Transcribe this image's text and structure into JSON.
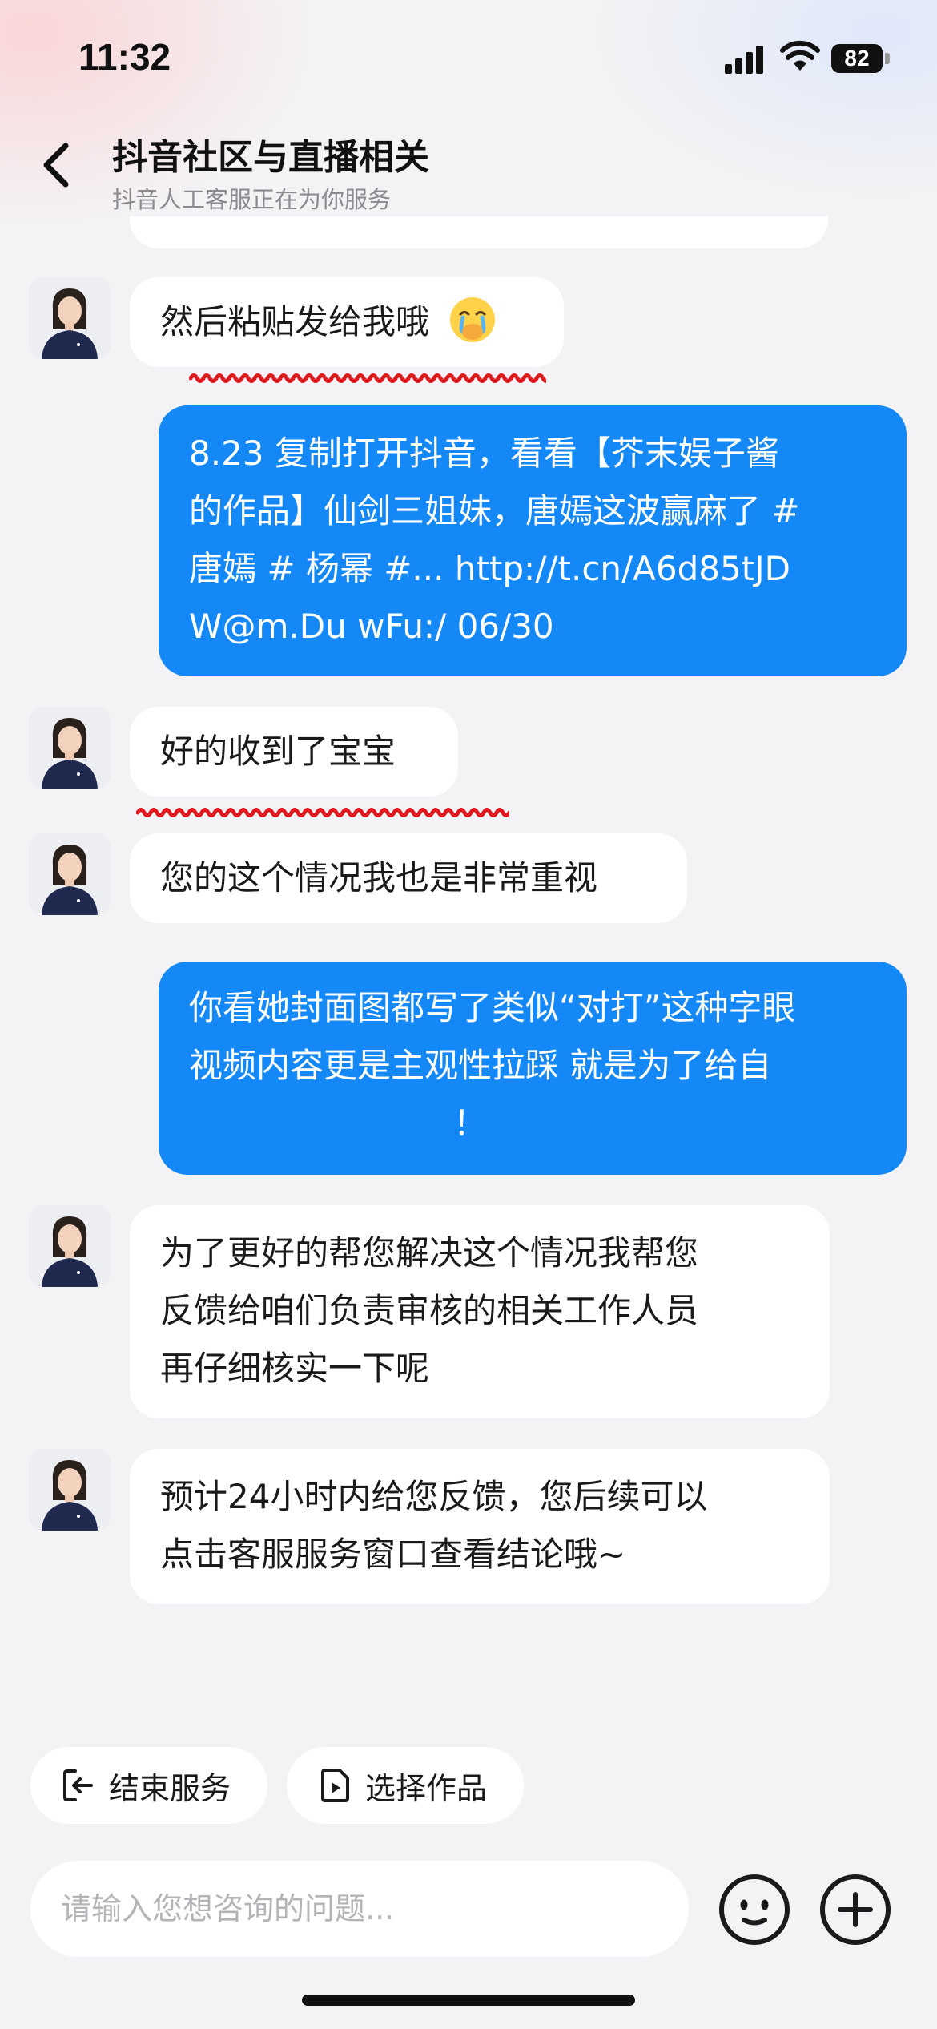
{
  "status_bar": {
    "time": "11:32",
    "battery": "82"
  },
  "header": {
    "title": "抖音社区与直播相关",
    "subtitle": "抖音人工客服正在为你服务"
  },
  "messages": [
    {
      "from": "agent",
      "text": "然后粘贴发给我哦",
      "emoji": "crying-hand-over-mouth-emoji"
    },
    {
      "from": "user",
      "lines": [
        "8.23 复制打开抖音，看看【芥末娱子酱",
        "的作品】仙剑三姐妹，唐嫣这波赢麻了 #",
        "唐嫣 # 杨幂 #... http://t.cn/A6d85tJD",
        "W@m.Du wFu:/ 06/30"
      ]
    },
    {
      "from": "agent",
      "text": "好的收到了宝宝"
    },
    {
      "from": "agent",
      "text": "您的这个情况我也是非常重视"
    },
    {
      "from": "user",
      "lines": [
        "你看她封面图都写了类似“对打”这种字眼",
        "视频内容更是主观性拉踩 就是为了给自",
        "！"
      ]
    },
    {
      "from": "agent",
      "lines": [
        "为了更好的帮您解决这个情况我帮您",
        "反馈给咱们负责审核的相关工作人员",
        "再仔细核实一下呢"
      ]
    },
    {
      "from": "agent",
      "lines": [
        "预计24小时内给您反馈，您后续可以",
        "点击客服服务窗口查看结论哦~"
      ]
    }
  ],
  "actions": {
    "end_service": "结束服务",
    "select_work": "选择作品"
  },
  "input": {
    "placeholder": "请输入您想咨询的问题..."
  },
  "colors": {
    "user_bubble": "#1388f6",
    "agent_bubble": "#ffffff",
    "background": "#f3f3f5",
    "squiggle": "#e0191e"
  }
}
